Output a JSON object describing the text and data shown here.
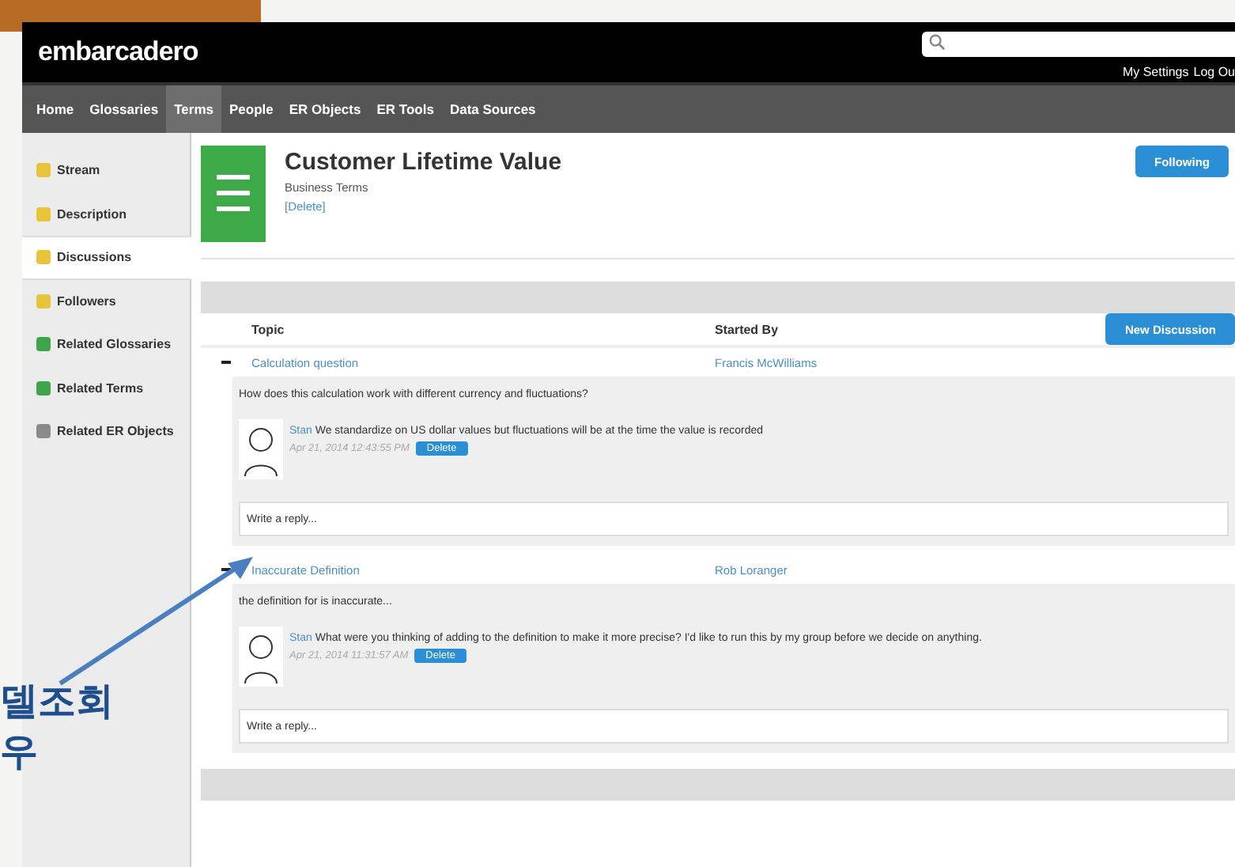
{
  "header": {
    "logo": "embarcadero",
    "user_links": [
      "My Settings",
      "Log Ou"
    ]
  },
  "nav": [
    {
      "label": "Home",
      "selected": false
    },
    {
      "label": "Glossaries",
      "selected": false
    },
    {
      "label": "Terms",
      "selected": true
    },
    {
      "label": "People",
      "selected": false
    },
    {
      "label": "ER Objects",
      "selected": false
    },
    {
      "label": "ER Tools",
      "selected": false
    },
    {
      "label": "Data Sources",
      "selected": false
    }
  ],
  "sidebar": [
    {
      "label": "Stream",
      "selected": false,
      "color": "#e8c43a"
    },
    {
      "label": "Description",
      "selected": false,
      "color": "#e8c43a"
    },
    {
      "label": "Discussions",
      "selected": true,
      "color": "#e8c43a"
    },
    {
      "label": "Followers",
      "selected": false,
      "color": "#e8c43a"
    },
    {
      "label": "Related Glossaries",
      "selected": false,
      "color": "#3ea54a"
    },
    {
      "label": "Related Terms",
      "selected": false,
      "color": "#3ea54a"
    },
    {
      "label": "Related ER Objects",
      "selected": false,
      "color": "#8a8a8a"
    }
  ],
  "term": {
    "title": "Customer Lifetime Value",
    "type": "Business Terms",
    "delete": "[Delete]",
    "follow_button": "Following"
  },
  "discussions": {
    "columns": [
      "Topic",
      "Started By"
    ],
    "new_button": "New Discussion",
    "threads": [
      {
        "expanded": true,
        "topic": "Calculation question",
        "started_by": "Francis McWilliams",
        "body": "How does this calculation work with different currency and fluctuations?",
        "replies": [
          {
            "author": "Stan",
            "text": "We standardize on US dollar values but fluctuations will be at the time the value is recorded",
            "date": "Apr 21, 2014 12:43:55 PM",
            "delete": "Delete"
          }
        ],
        "reply_placeholder": "Write a reply..."
      },
      {
        "expanded": true,
        "topic": "Inaccurate Definition",
        "started_by": "Rob Loranger",
        "body": "the definition for is inaccurate...",
        "replies": [
          {
            "author": "Stan",
            "text": "What were you thinking of adding to the definition to make it more precise? I'd like to run this by my group before we decide on anything.",
            "date": "Apr 21, 2014 11:31:57 AM",
            "delete": "Delete"
          }
        ],
        "reply_placeholder": "Write a reply..."
      }
    ]
  },
  "annotation": {
    "lines": [
      "델조회",
      "우"
    ]
  }
}
